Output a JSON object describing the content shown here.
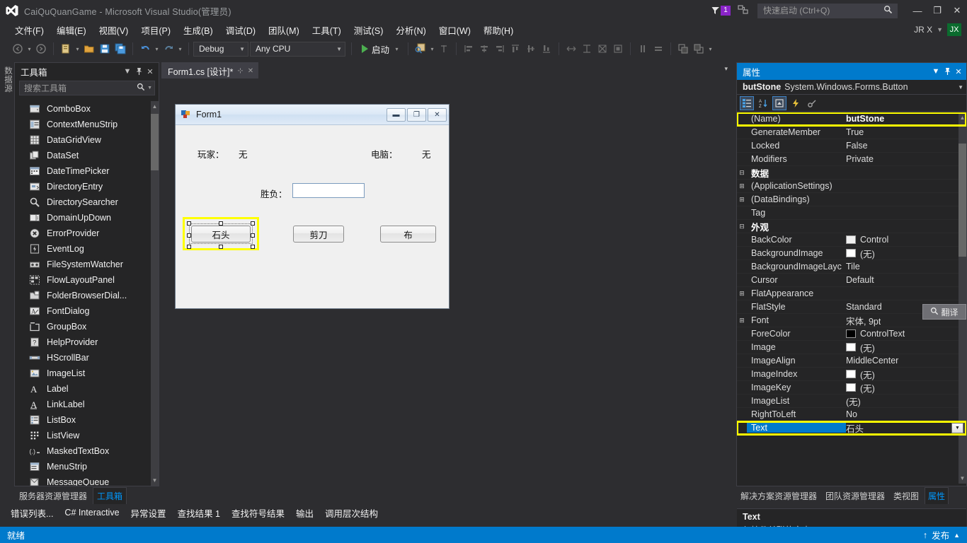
{
  "titlebar": {
    "title": "CaiQuQuanGame - Microsoft Visual Studio(管理员)",
    "notification_count": "1",
    "quick_launch_placeholder": "快速启动 (Ctrl+Q)",
    "quick_launch_value": "",
    "minimize": "—",
    "restore": "❐",
    "close": "✕",
    "account_name": "JR X",
    "account_initials": "JX"
  },
  "menu": {
    "items": [
      {
        "label": "文件(F)"
      },
      {
        "label": "编辑(E)"
      },
      {
        "label": "视图(V)"
      },
      {
        "label": "项目(P)"
      },
      {
        "label": "生成(B)"
      },
      {
        "label": "调试(D)"
      },
      {
        "label": "团队(M)"
      },
      {
        "label": "工具(T)"
      },
      {
        "label": "测试(S)"
      },
      {
        "label": "分析(N)"
      },
      {
        "label": "窗口(W)"
      },
      {
        "label": "帮助(H)"
      }
    ]
  },
  "toolbar": {
    "configuration": "Debug",
    "platform": "Any CPU",
    "run_label": "启动",
    "icons": [
      "navigate-back-icon",
      "navigate-forward-icon",
      "new-project-icon",
      "open-file-icon",
      "save-icon",
      "save-all-icon",
      "undo-icon",
      "redo-icon",
      "find-icon",
      "tab-order-icon",
      "align-lefts-icon",
      "align-centers-icon",
      "align-rights-icon",
      "align-tops-icon",
      "align-middles-icon",
      "align-bottoms-icon",
      "make-same-width-icon",
      "make-same-height-icon",
      "make-same-size-icon",
      "size-to-grid-icon",
      "horizontal-spacing-icon",
      "vertical-spacing-icon",
      "bring-to-front-icon",
      "send-to-back-icon"
    ]
  },
  "left_rail": {
    "label": "数据源"
  },
  "toolbox": {
    "title": "工具箱",
    "search_placeholder": "搜索工具箱",
    "search_value": "",
    "items": [
      {
        "label": "ComboBox",
        "icon": "combobox-icon"
      },
      {
        "label": "ContextMenuStrip",
        "icon": "contextmenustrip-icon"
      },
      {
        "label": "DataGridView",
        "icon": "datagridview-icon"
      },
      {
        "label": "DataSet",
        "icon": "dataset-icon"
      },
      {
        "label": "DateTimePicker",
        "icon": "datetimepicker-icon"
      },
      {
        "label": "DirectoryEntry",
        "icon": "directoryentry-icon"
      },
      {
        "label": "DirectorySearcher",
        "icon": "directorysearcher-icon"
      },
      {
        "label": "DomainUpDown",
        "icon": "domainupdown-icon"
      },
      {
        "label": "ErrorProvider",
        "icon": "errorprovider-icon"
      },
      {
        "label": "EventLog",
        "icon": "eventlog-icon"
      },
      {
        "label": "FileSystemWatcher",
        "icon": "filesystemwatcher-icon"
      },
      {
        "label": "FlowLayoutPanel",
        "icon": "flowlayoutpanel-icon"
      },
      {
        "label": "FolderBrowserDial...",
        "icon": "folderbrowserdialog-icon"
      },
      {
        "label": "FontDialog",
        "icon": "fontdialog-icon"
      },
      {
        "label": "GroupBox",
        "icon": "groupbox-icon"
      },
      {
        "label": "HelpProvider",
        "icon": "helpprovider-icon"
      },
      {
        "label": "HScrollBar",
        "icon": "hscrollbar-icon"
      },
      {
        "label": "ImageList",
        "icon": "imagelist-icon"
      },
      {
        "label": "Label",
        "icon": "label-icon"
      },
      {
        "label": "LinkLabel",
        "icon": "linklabel-icon"
      },
      {
        "label": "ListBox",
        "icon": "listbox-icon"
      },
      {
        "label": "ListView",
        "icon": "listview-icon"
      },
      {
        "label": "MaskedTextBox",
        "icon": "maskedtextbox-icon"
      },
      {
        "label": "MenuStrip",
        "icon": "menustrip-icon"
      },
      {
        "label": "MessageQueue",
        "icon": "messagequeue-icon"
      }
    ],
    "bottom_tabs": [
      {
        "label": "服务器资源管理器",
        "active": false
      },
      {
        "label": "工具箱",
        "active": true
      }
    ]
  },
  "document": {
    "tab_label": "Form1.cs [设计]*",
    "form": {
      "title": "Form1",
      "minimize": "▬",
      "maximize": "❐",
      "close": "✕",
      "labels": [
        {
          "name": "player-label",
          "text": "玩家："
        },
        {
          "name": "player-value",
          "text": "无"
        },
        {
          "name": "computer-label",
          "text": "电脑："
        },
        {
          "name": "computer-value",
          "text": "无"
        },
        {
          "name": "result-label",
          "text": "胜负："
        }
      ],
      "result_textbox_value": "",
      "buttons": [
        {
          "name": "butStone",
          "text": "石头",
          "selected": true
        },
        {
          "name": "butScissors",
          "text": "剪刀",
          "selected": false
        },
        {
          "name": "butCloth",
          "text": "布",
          "selected": false
        }
      ]
    }
  },
  "properties": {
    "title": "属性",
    "object_name": "butStone",
    "object_type": "System.Windows.Forms.Button",
    "toolbar_buttons": [
      {
        "name": "categorized-icon",
        "active": true
      },
      {
        "name": "alphabetical-icon",
        "active": false
      },
      {
        "name": "properties-icon",
        "active": true
      },
      {
        "name": "events-icon",
        "active": false
      },
      {
        "name": "property-pages-icon",
        "active": false
      }
    ],
    "rows": [
      {
        "name": "(Name)",
        "value": "butStone",
        "kind": "prop",
        "bold": true,
        "highlight": true
      },
      {
        "name": "GenerateMember",
        "value": "True",
        "kind": "prop"
      },
      {
        "name": "Locked",
        "value": "False",
        "kind": "prop"
      },
      {
        "name": "Modifiers",
        "value": "Private",
        "kind": "prop"
      },
      {
        "name": "数据",
        "value": "",
        "kind": "category",
        "expander": "−"
      },
      {
        "name": "(ApplicationSettings)",
        "value": "",
        "kind": "prop",
        "expander": "+"
      },
      {
        "name": "(DataBindings)",
        "value": "",
        "kind": "prop",
        "expander": "+"
      },
      {
        "name": "Tag",
        "value": "",
        "kind": "prop"
      },
      {
        "name": "外观",
        "value": "",
        "kind": "category",
        "expander": "−"
      },
      {
        "name": "BackColor",
        "value": "Control",
        "kind": "prop",
        "swatch": "#f0f0f0"
      },
      {
        "name": "BackgroundImage",
        "value": "(无)",
        "kind": "prop",
        "swatch": "#ffffff"
      },
      {
        "name": "BackgroundImageLayc",
        "value": "Tile",
        "kind": "prop"
      },
      {
        "name": "Cursor",
        "value": "Default",
        "kind": "prop"
      },
      {
        "name": "FlatAppearance",
        "value": "",
        "kind": "prop",
        "expander": "+"
      },
      {
        "name": "FlatStyle",
        "value": "Standard",
        "kind": "prop"
      },
      {
        "name": "Font",
        "value": "宋体, 9pt",
        "kind": "prop",
        "expander": "+"
      },
      {
        "name": "ForeColor",
        "value": "ControlText",
        "kind": "prop",
        "swatch": "#000000"
      },
      {
        "name": "Image",
        "value": "(无)",
        "kind": "prop",
        "swatch": "#ffffff"
      },
      {
        "name": "ImageAlign",
        "value": "MiddleCenter",
        "kind": "prop"
      },
      {
        "name": "ImageIndex",
        "value": "(无)",
        "kind": "prop",
        "swatch": "#ffffff"
      },
      {
        "name": "ImageKey",
        "value": "(无)",
        "kind": "prop",
        "swatch": "#ffffff"
      },
      {
        "name": "ImageList",
        "value": "(无)",
        "kind": "prop"
      },
      {
        "name": "RightToLeft",
        "value": "No",
        "kind": "prop"
      },
      {
        "name": "Text",
        "value": "石头",
        "kind": "prop",
        "selected": true,
        "highlight": true,
        "dropdown": true
      }
    ],
    "description_title": "Text",
    "description_body": "与控件关联的文本。",
    "translate_popup": "翻译",
    "bottom_tabs": [
      {
        "label": "解决方案资源管理器",
        "active": false
      },
      {
        "label": "团队资源管理器",
        "active": false
      },
      {
        "label": "类视图",
        "active": false
      },
      {
        "label": "属性",
        "active": true
      }
    ]
  },
  "bottom_tabs": [
    {
      "label": "错误列表..."
    },
    {
      "label": "C# Interactive"
    },
    {
      "label": "异常设置"
    },
    {
      "label": "查找结果 1"
    },
    {
      "label": "查找符号结果"
    },
    {
      "label": "输出"
    },
    {
      "label": "调用层次结构"
    }
  ],
  "statusbar": {
    "state": "就绪",
    "publish": "发布"
  },
  "colors": {
    "accent": "#007acc",
    "highlight": "#ffff00",
    "badge": "#8a24c9",
    "avatar": "#0b6b2e",
    "play": "#4caf50"
  }
}
